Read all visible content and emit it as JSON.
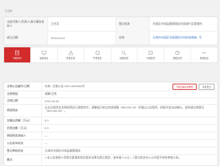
{
  "header": {
    "tag": "已注销"
  },
  "info": {
    "r1": {
      "label1": "法定代表人/负责人/执行事务合伙人",
      "value1": "王艺芳",
      "label2": "登记机关",
      "value2": "东丽区市场监督管理局东丽湖片区管理所"
    },
    "r2": {
      "label1": "成立日期",
      "value1": "2020-03-31",
      "label2": "住所",
      "value2": "天津市东丽区东丽湖恒大科技旅游城...号"
    }
  },
  "tabs": [
    {
      "label": "行政许可",
      "icon": "license-icon"
    },
    {
      "label": "监管信息",
      "icon": "monitor-icon"
    },
    {
      "label": "异常名录",
      "icon": "abnormal-icon"
    },
    {
      "label": "严重违法",
      "icon": "serious-violation-icon"
    },
    {
      "label": "抽查检查",
      "icon": "inspection-icon"
    },
    {
      "label": "行政处罚",
      "icon": "penalty-icon"
    },
    {
      "label": "股权出质",
      "icon": "equity-icon"
    },
    {
      "label": "其他信息",
      "icon": "other-icon"
    }
  ],
  "detail": {
    "notice_no": {
      "label": "注销公告编号/日期",
      "value": "东湖...注销公告 2021-0000000号",
      "btn1": "下载注销公告附件",
      "btn2": "查看登记"
    },
    "reason": {
      "label": "注销原因",
      "value": "清算/注销"
    },
    "date": {
      "label": "注销日期",
      "value": "2021-06-18"
    },
    "debt": {
      "label": "债权债务",
      "value": "企业注册资本及债权债务已清理完毕，清算组已依法完成清算（¥50,000.00）并通过公告程序，经股东会决议确认，现申请注销登记（¥50,000.00）。"
    },
    "assets": {
      "label": "实缴出资额（万元）",
      "value": "5.0"
    },
    "liability": {
      "label": "负债总额（万元）",
      "value": "0.0"
    },
    "receiver": {
      "label": "债权债务承接人",
      "value": "—"
    },
    "publisher": {
      "label": "公告发布机关",
      "value": "—"
    },
    "agency": {
      "label": "登记审核机关",
      "value": "天津市东丽区市场监督管理局"
    },
    "note": {
      "label": "备注",
      "value": "1.本公告依照公司登记管理条例及相关法律法规之规定，由申请人公示；2.登记机关对公示内容不承担审查义务。"
    }
  },
  "colors": {
    "accent": "#d22b2b",
    "link": "#3a6fc8"
  }
}
